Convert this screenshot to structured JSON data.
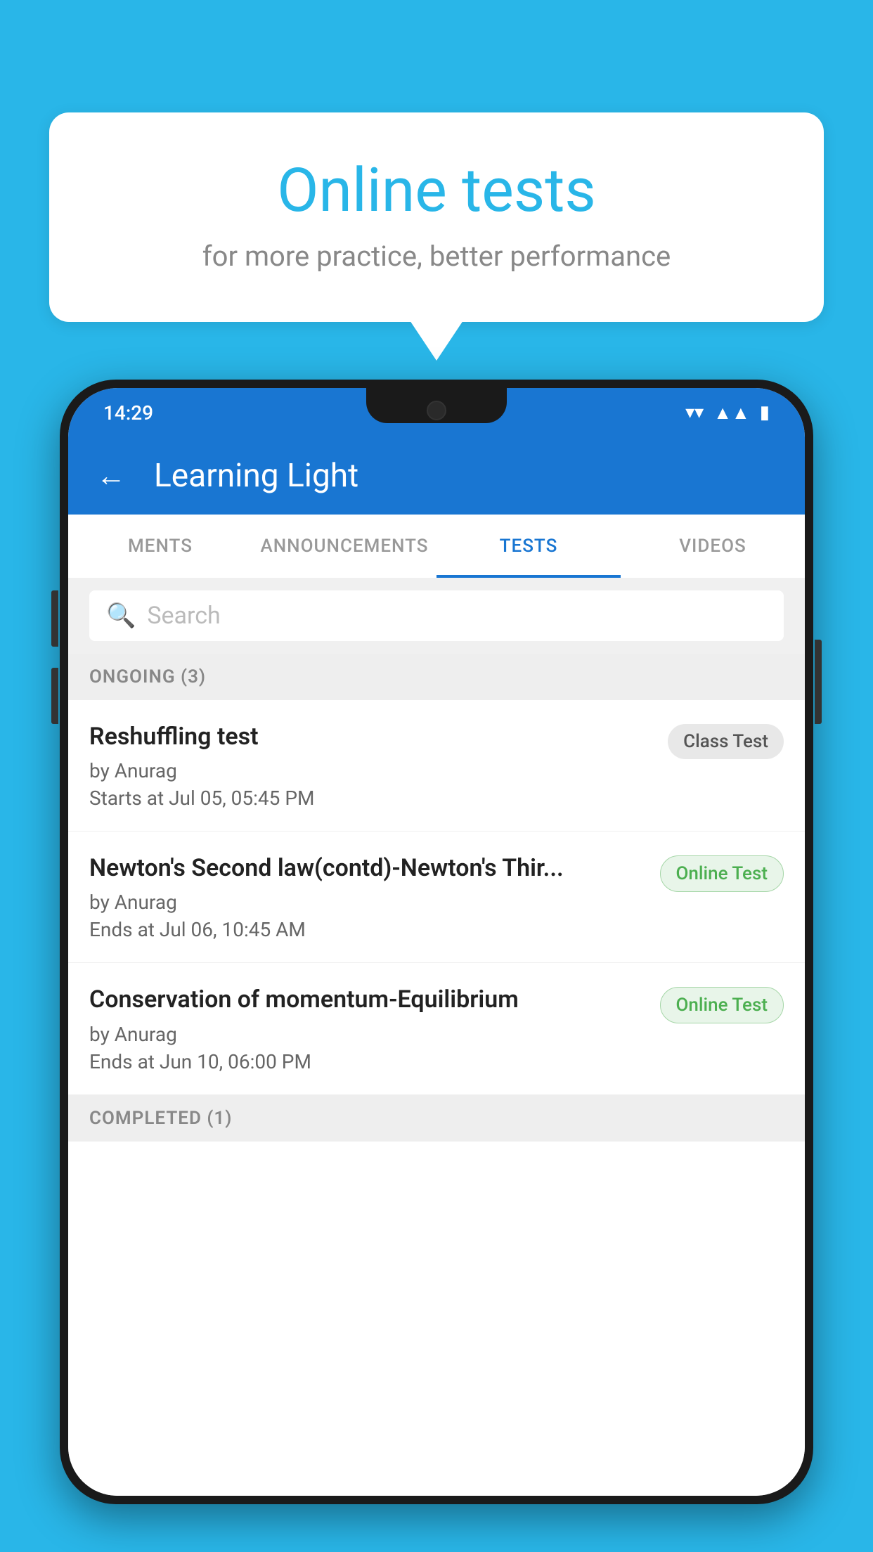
{
  "background_color": "#29b6e8",
  "speech_bubble": {
    "title": "Online tests",
    "subtitle": "for more practice, better performance"
  },
  "status_bar": {
    "time": "14:29",
    "wifi_icon": "▼",
    "signal_icon": "▲",
    "battery_icon": "▮"
  },
  "app_header": {
    "back_label": "←",
    "title": "Learning Light"
  },
  "tabs": [
    {
      "label": "MENTS",
      "active": false
    },
    {
      "label": "ANNOUNCEMENTS",
      "active": false
    },
    {
      "label": "TESTS",
      "active": true
    },
    {
      "label": "VIDEOS",
      "active": false
    }
  ],
  "search": {
    "placeholder": "Search"
  },
  "sections": {
    "ongoing": {
      "label": "ONGOING (3)",
      "tests": [
        {
          "name": "Reshuffling test",
          "author": "by Anurag",
          "date": "Starts at  Jul 05, 05:45 PM",
          "badge": "Class Test",
          "badge_type": "class"
        },
        {
          "name": "Newton's Second law(contd)-Newton's Thir...",
          "author": "by Anurag",
          "date": "Ends at  Jul 06, 10:45 AM",
          "badge": "Online Test",
          "badge_type": "online"
        },
        {
          "name": "Conservation of momentum-Equilibrium",
          "author": "by Anurag",
          "date": "Ends at  Jun 10, 06:00 PM",
          "badge": "Online Test",
          "badge_type": "online"
        }
      ]
    },
    "completed": {
      "label": "COMPLETED (1)"
    }
  }
}
